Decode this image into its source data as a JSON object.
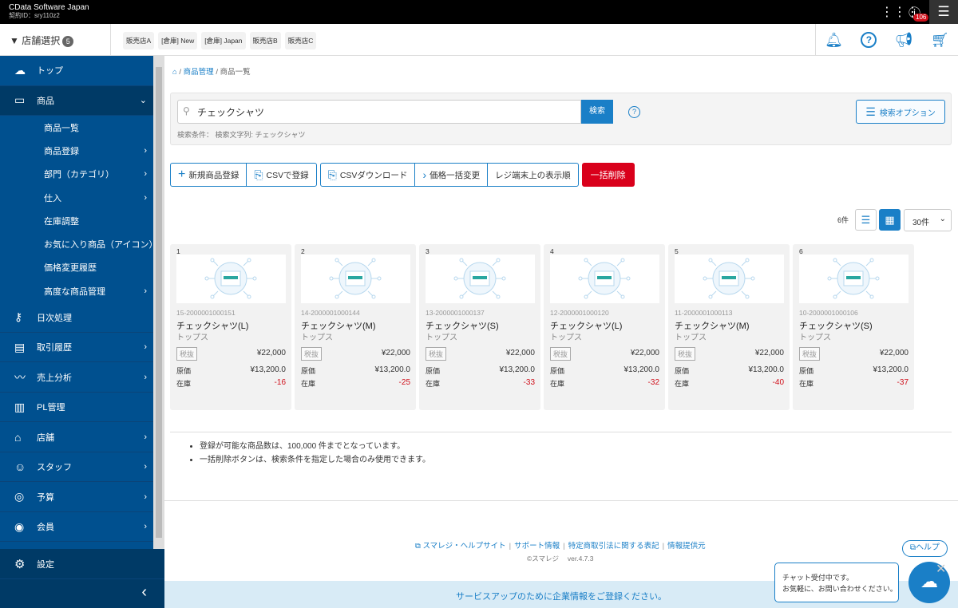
{
  "topbar": {
    "company": "CData Software Japan",
    "contract": "契約ID：sry110z2",
    "notifications": "106"
  },
  "store_select": {
    "label": "店舗選択",
    "count": "5",
    "tags": [
      "販売店A",
      "[倉庫] New",
      "[倉庫] Japan",
      "販売店B",
      "販売店C"
    ]
  },
  "sidebar": {
    "items": [
      {
        "label": "トップ",
        "icon": "cloud-icon",
        "glyph": "☁"
      },
      {
        "label": "商品",
        "icon": "box-icon",
        "glyph": "▭",
        "active": true,
        "open": true
      },
      {
        "label": "日次処理",
        "icon": "key-icon",
        "glyph": "⚷"
      },
      {
        "label": "取引履歴",
        "icon": "receipt-icon",
        "glyph": "▤",
        "chev": true
      },
      {
        "label": "売上分析",
        "icon": "chart-icon",
        "glyph": "〰",
        "chev": true
      },
      {
        "label": "PL管理",
        "icon": "document-icon",
        "glyph": "▥"
      },
      {
        "label": "店舗",
        "icon": "store-icon",
        "glyph": "⌂",
        "chev": true
      },
      {
        "label": "スタッフ",
        "icon": "staff-icon",
        "glyph": "☺",
        "chev": true
      },
      {
        "label": "予算",
        "icon": "target-icon",
        "glyph": "◎",
        "chev": true
      },
      {
        "label": "会員",
        "icon": "member-icon",
        "glyph": "◉",
        "chev": true
      }
    ],
    "sub_items": [
      {
        "label": "商品一覧"
      },
      {
        "label": "商品登録",
        "chev": true
      },
      {
        "label": "部門（カテゴリ）",
        "chev": true
      },
      {
        "label": "仕入",
        "chev": true
      },
      {
        "label": "在庫調整"
      },
      {
        "label": "お気に入り商品（アイコン）"
      },
      {
        "label": "価格変更履歴"
      },
      {
        "label": "高度な商品管理",
        "chev": true
      }
    ],
    "settings": "設定"
  },
  "breadcrumb": [
    "商品管理",
    "商品一覧"
  ],
  "search": {
    "value": "チェックシャツ",
    "button": "検索",
    "condition": "検索条件： 検索文字列: チェックシャツ",
    "options": "検索オプション"
  },
  "actions": {
    "new": "新規商品登録",
    "csv_register": "CSVで登録",
    "csv_download": "CSVダウンロード",
    "bulk_price": "価格一括変更",
    "register_order": "レジ端末上の表示順",
    "bulk_delete": "一括削除"
  },
  "list": {
    "count": "6件",
    "per_page": "30件"
  },
  "products": [
    {
      "no": "1",
      "code": "15-2000001000151",
      "name": "チェックシャツ(L)",
      "category": "トップス",
      "tax": "税抜",
      "price": "¥22,000",
      "cost_label": "原価",
      "cost": "¥13,200.0",
      "stock_label": "在庫",
      "stock": "-16"
    },
    {
      "no": "2",
      "code": "14-2000001000144",
      "name": "チェックシャツ(M)",
      "category": "トップス",
      "tax": "税抜",
      "price": "¥22,000",
      "cost_label": "原価",
      "cost": "¥13,200.0",
      "stock_label": "在庫",
      "stock": "-25"
    },
    {
      "no": "3",
      "code": "13-2000001000137",
      "name": "チェックシャツ(S)",
      "category": "トップス",
      "tax": "税抜",
      "price": "¥22,000",
      "cost_label": "原価",
      "cost": "¥13,200.0",
      "stock_label": "在庫",
      "stock": "-33"
    },
    {
      "no": "4",
      "code": "12-2000001000120",
      "name": "チェックシャツ(L)",
      "category": "トップス",
      "tax": "税抜",
      "price": "¥22,000",
      "cost_label": "原価",
      "cost": "¥13,200.0",
      "stock_label": "在庫",
      "stock": "-32"
    },
    {
      "no": "5",
      "code": "11-2000001000113",
      "name": "チェックシャツ(M)",
      "category": "トップス",
      "tax": "税抜",
      "price": "¥22,000",
      "cost_label": "原価",
      "cost": "¥13,200.0",
      "stock_label": "在庫",
      "stock": "-40"
    },
    {
      "no": "6",
      "code": "10-2000001000106",
      "name": "チェックシャツ(S)",
      "category": "トップス",
      "tax": "税抜",
      "price": "¥22,000",
      "cost_label": "原価",
      "cost": "¥13,200.0",
      "stock_label": "在庫",
      "stock": "-37"
    }
  ],
  "notes": [
    "登録が可能な商品数は、100,000 件までとなっています。",
    "一括削除ボタンは、検索条件を指定した場合のみ使用できます。"
  ],
  "footer": {
    "links": [
      "スマレジ・ヘルプサイト",
      "サポート情報",
      "特定商取引法に関する表記",
      "情報提供元"
    ],
    "copyright": "©スマレジ　 ver.4.7.3",
    "help": "ヘルプ"
  },
  "banner": "サービスアップのために企業情報をご登録ください。",
  "chat": {
    "line1": "チャット受付中です。",
    "line2": "お気軽に、お問い合わせください。"
  },
  "colors": {
    "sidebar": "#00508f",
    "sidebar_active": "#003a66",
    "accent": "#1a7fc7",
    "danger": "#d9001b"
  }
}
